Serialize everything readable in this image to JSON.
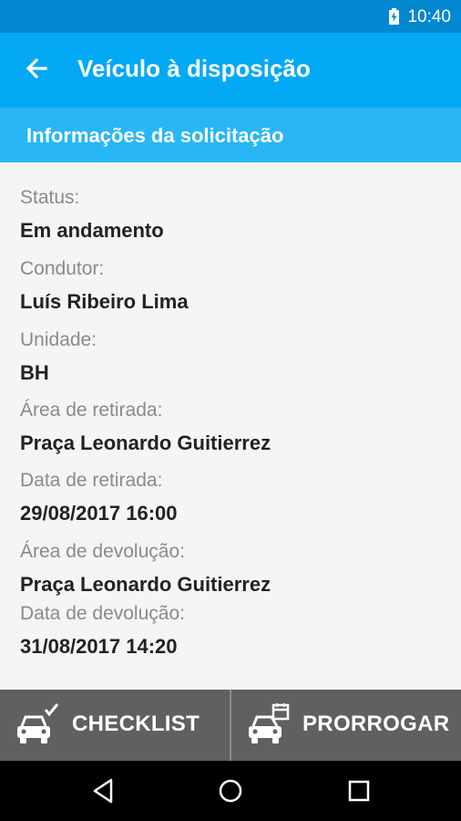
{
  "status_bar": {
    "time": "10:40"
  },
  "app_bar": {
    "title": "Veículo à disposição"
  },
  "section": {
    "title": "Informações da solicitação"
  },
  "fields": [
    {
      "label": "Status:",
      "value": "Em andamento"
    },
    {
      "label": "Condutor:",
      "value": "Luís Ribeiro Lima"
    },
    {
      "label": "Unidade:",
      "value": "BH"
    },
    {
      "label": "Área de retirada:",
      "value": "Praça Leonardo Guitierrez"
    },
    {
      "label": "Data de retirada:",
      "value": "29/08/2017 16:00"
    },
    {
      "label": "Área de devolução:",
      "value": "Praça Leonardo Guitierrez"
    },
    {
      "label": "Data de devolução:",
      "value": "31/08/2017 14:20"
    }
  ],
  "actions": {
    "checklist_label": "CHECKLIST",
    "checklist_icon": "car-check-icon",
    "extend_label": "PRORROGAR",
    "extend_icon": "car-calendar-icon"
  },
  "colors": {
    "status_bar": "#0288d1",
    "app_bar": "#03a9f4",
    "section_header": "#29b6f6",
    "action_bar": "#606060"
  }
}
